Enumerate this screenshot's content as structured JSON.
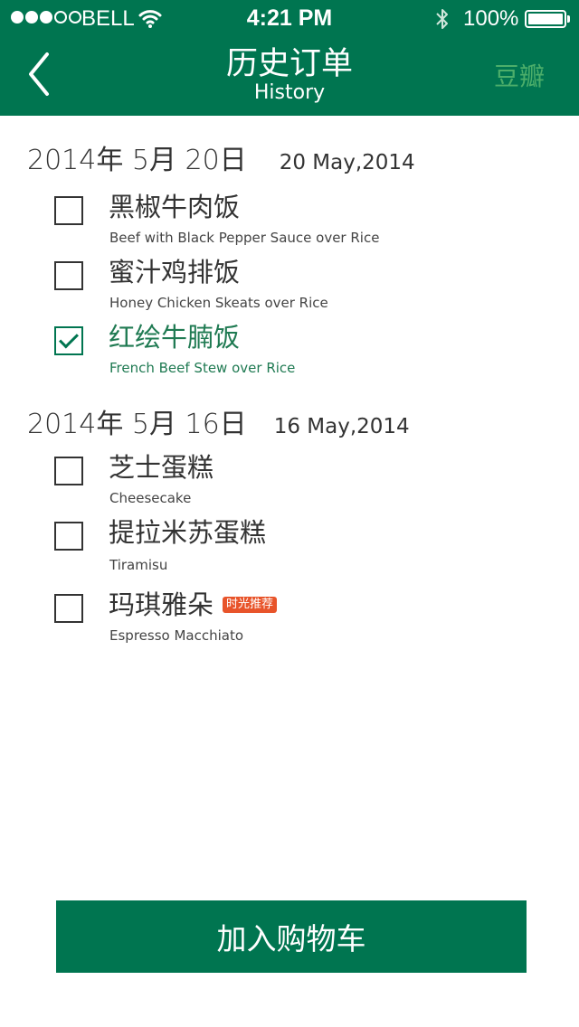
{
  "status_bar": {
    "carrier": "BELL",
    "time": "4:21 PM",
    "battery": "100%",
    "signal_bars_filled": 3,
    "signal_bars_total": 5
  },
  "nav": {
    "title": "历史订单",
    "subtitle": "History",
    "right_label": "豆瓣"
  },
  "groups": [
    {
      "date_cn": "2014年 5月 20日",
      "date_en": "20 May,2014",
      "items": [
        {
          "name": "黑椒牛肉饭",
          "name_en": "Beef with Black Pepper Sauce over Rice",
          "checked": false
        },
        {
          "name": "蜜汁鸡排饭",
          "name_en": "Honey Chicken Skeats over Rice",
          "checked": false
        },
        {
          "name": "红绘牛腩饭",
          "name_en": "French Beef Stew over Rice",
          "checked": true
        }
      ]
    },
    {
      "date_cn": "2014年 5月 16日",
      "date_en": "16 May,2014",
      "items": [
        {
          "name": "芝士蛋糕",
          "name_en": "Cheesecake",
          "checked": false
        },
        {
          "name": "提拉米苏蛋糕",
          "name_en": "Tiramisu",
          "checked": false
        },
        {
          "name": "玛琪雅朵",
          "name_en": "Espresso Macchiato",
          "checked": false,
          "badge": "时光推荐"
        }
      ]
    }
  ],
  "cart_button": "加入购物车",
  "colors": {
    "primary": "#007550",
    "checked_text": "#1f7a52",
    "badge": "#e8542a",
    "nav_right": "#4cae6a"
  }
}
